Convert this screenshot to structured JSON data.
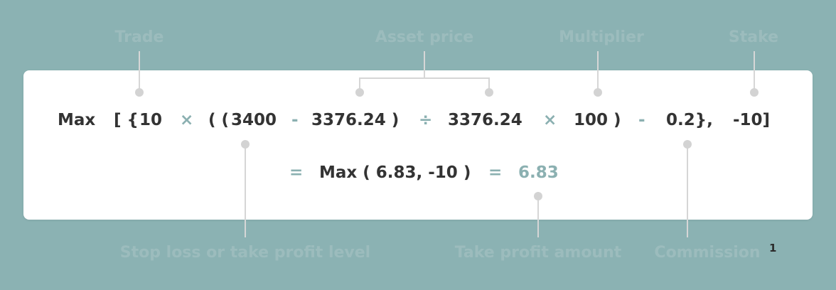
{
  "labels": {
    "trade": "Trade",
    "asset_price": "Asset price",
    "multiplier": "Multiplier",
    "stake": "Stake",
    "stop_loss_take_profit_level": "Stop loss or take profit level",
    "take_profit_amount": "Take profit amount",
    "commission": "Commission",
    "footnote_marker": "1"
  },
  "formula": {
    "max_fn": "Max",
    "open_brackets": "[ {",
    "trade_value": "10",
    "times_1": "×",
    "open_parens": "( (",
    "level_value": "3400",
    "minus_1": "-",
    "entry_price_1": "3376.24 )",
    "divide": "÷",
    "entry_price_2": "3376.24",
    "times_2": "×",
    "multiplier_value": "100 )",
    "minus_2": "-",
    "commission_value": "0.2},",
    "stake_value": "-10]"
  },
  "result": {
    "equals_1": "=",
    "max_expression": "Max ( 6.83, -10 )",
    "equals_2": "=",
    "final_value": "6.83"
  },
  "colors": {
    "background": "#8bb2b3",
    "card": "#ffffff",
    "text": "#333333",
    "operator": "#8bb0b1",
    "connector": "#d6d6d6"
  }
}
